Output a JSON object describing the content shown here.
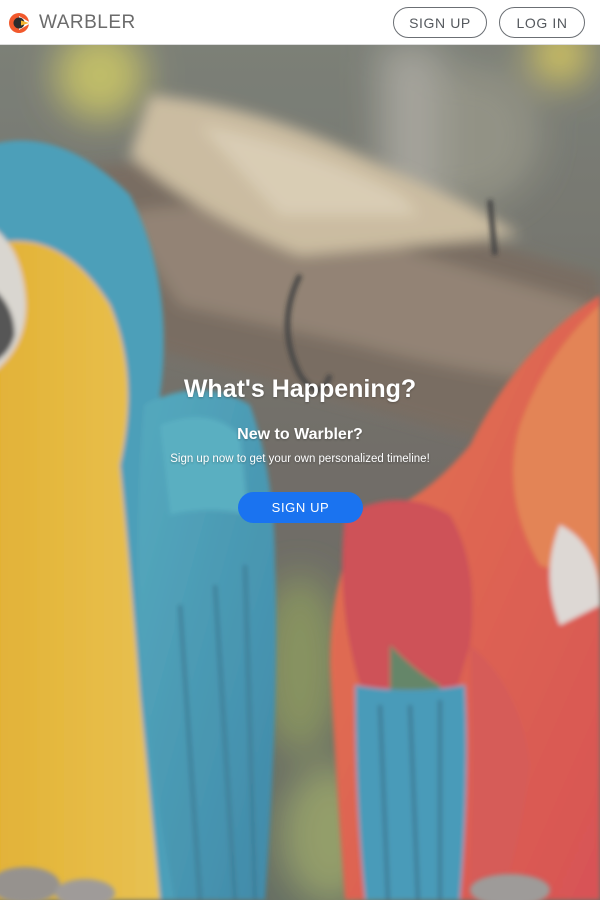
{
  "navbar": {
    "brand_name": "WARBLER",
    "signup_label": "SIGN UP",
    "login_label": "LOG IN"
  },
  "hero": {
    "title": "What's Happening?",
    "subtitle": "New to Warbler?",
    "text": "Sign up now to get your own personalized timeline!",
    "signup_label": "SIGN UP",
    "background": "parrots-photo"
  },
  "colors": {
    "primary_button": "#1a73f0",
    "logo_orange": "#f2592c",
    "logo_dark": "#2d2d2d"
  }
}
